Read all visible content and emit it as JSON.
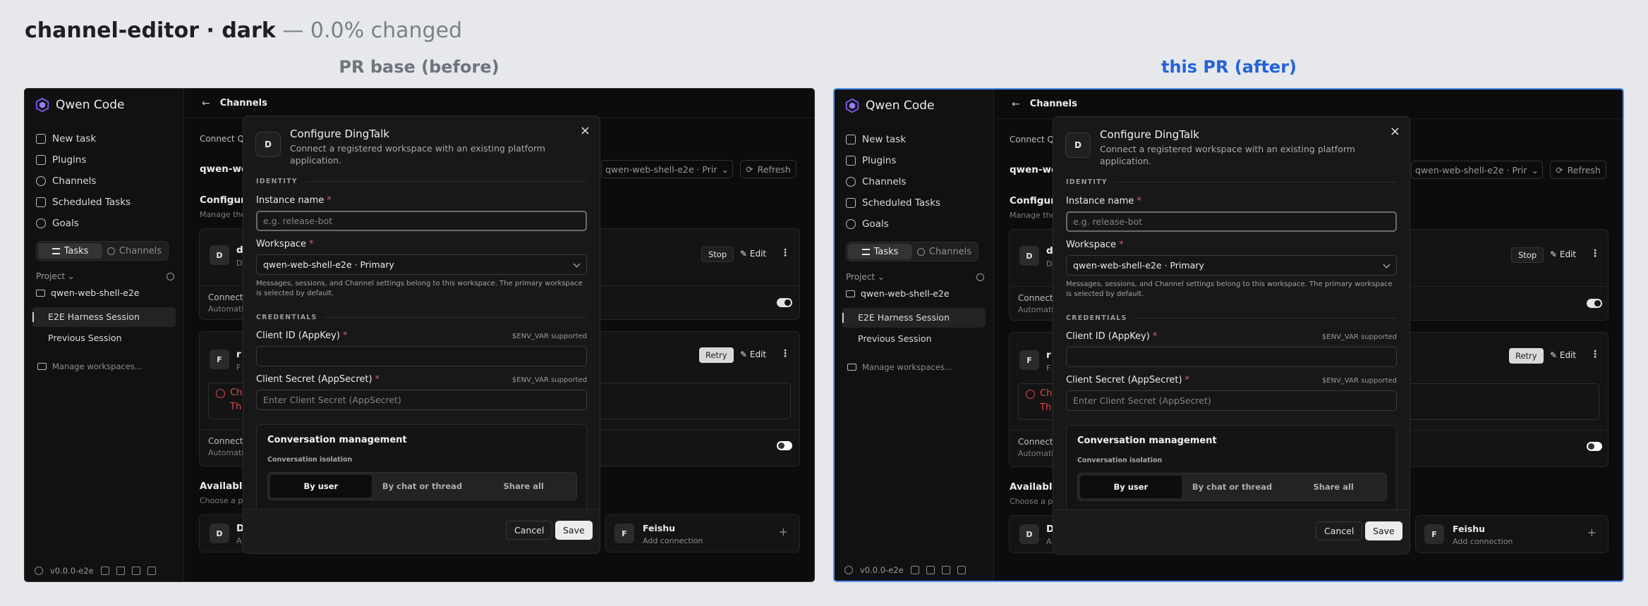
{
  "header": {
    "title_bold": "channel-editor · dark",
    "title_rest": "— 0.0% changed"
  },
  "panels": {
    "before_label": "PR base (before)",
    "after_label": "this PR (after)"
  },
  "app": {
    "name": "Qwen Code",
    "nav": [
      "New task",
      "Plugins",
      "Channels",
      "Scheduled Tasks",
      "Goals"
    ],
    "seg_tasks": "Tasks",
    "seg_channels": "Channels",
    "project_label": "Project",
    "folder": "qwen-web-shell-e2e",
    "sessions": [
      "E2E Harness Session",
      "Previous Session"
    ],
    "manage": "Manage workspaces...",
    "version": "v0.0.0-e2e"
  },
  "page": {
    "title": "Channels",
    "connect_hint": "Connect Q",
    "workspace_label": "qwen-web",
    "workspace_select": "qwen-web-shell-e2e · Prir",
    "refresh": "Refresh",
    "configured_title": "Configur",
    "configured_sub": "Manage the",
    "card1": {
      "avatar": "D",
      "name": "d",
      "sub": "D",
      "stop": "Stop",
      "edit": "Edit",
      "connect": "Connect",
      "auto": "Automatio"
    },
    "card2": {
      "avatar": "F",
      "name": "r",
      "sub": "F",
      "retry": "Retry",
      "edit": "Edit",
      "err1": "Ch",
      "err2": "Th",
      "connect": "Connect",
      "auto": "Automatio"
    },
    "available_title": "Available",
    "available_sub": "Choose a p",
    "avail1": {
      "avatar": "D",
      "name": "D",
      "sub": "A"
    },
    "avail2": {
      "avatar": "F",
      "name": "Feishu",
      "sub": "Add connection"
    }
  },
  "modal": {
    "avatar": "D",
    "title": "Configure DingTalk",
    "desc": "Connect a registered workspace with an existing platform application.",
    "close": "×",
    "section_identity": "IDENTITY",
    "instance_label": "Instance name",
    "instance_placeholder": "e.g. release-bot",
    "workspace_label": "Workspace",
    "workspace_value": "qwen-web-shell-e2e · Primary",
    "workspace_help": "Messages, sessions, and Channel settings belong to this workspace. The primary workspace is selected by default.",
    "section_credentials": "CREDENTIALS",
    "client_id_label": "Client ID (AppKey)",
    "client_secret_label": "Client Secret (AppSecret)",
    "env_hint": "$ENV_VAR supported",
    "client_secret_placeholder": "Enter Client Secret (AppSecret)",
    "required": "*",
    "conv_title": "Conversation management",
    "conv_sub": "Conversation isolation",
    "options": [
      "By user",
      "By chat or thread",
      "Share all"
    ],
    "cancel": "Cancel",
    "save": "Save"
  },
  "colors": {
    "accent_after": "#2463d8",
    "error": "#e04848",
    "before_label": "#6f747c"
  }
}
